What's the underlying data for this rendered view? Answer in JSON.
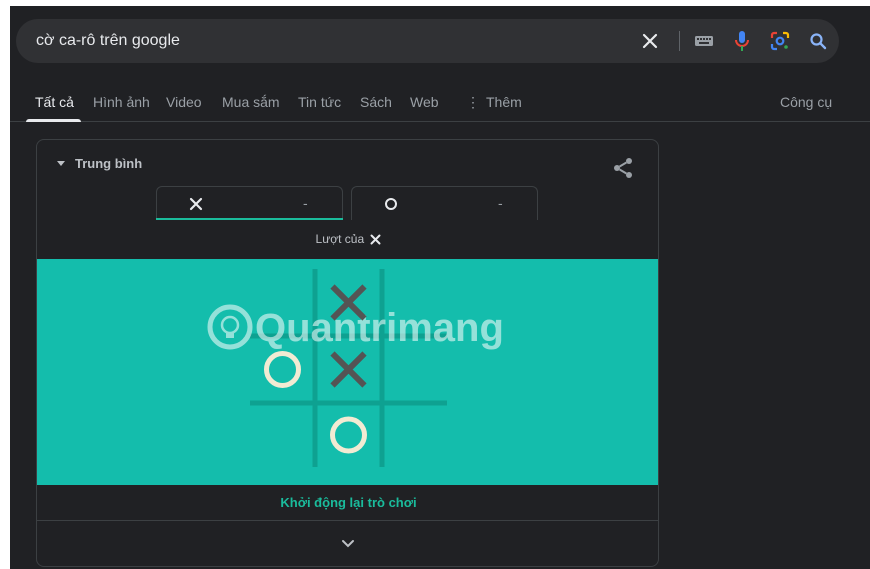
{
  "search": {
    "query": "cờ ca-rô trên google",
    "icons": [
      "close-icon",
      "keyboard-icon",
      "microphone-icon",
      "google-lens-icon",
      "search-icon"
    ]
  },
  "tabs": [
    {
      "label": "Tất cả",
      "active": true
    },
    {
      "label": "Hình ảnh"
    },
    {
      "label": "Video"
    },
    {
      "label": "Mua sắm"
    },
    {
      "label": "Tin tức"
    },
    {
      "label": "Sách"
    },
    {
      "label": "Web"
    },
    {
      "label": "Thêm",
      "icon": "more-vert-icon"
    }
  ],
  "tools_label": "Công cụ",
  "game": {
    "difficulty": "Trung bình",
    "players": [
      {
        "mark": "X",
        "score": "-"
      },
      {
        "mark": "O",
        "score": "-"
      }
    ],
    "turn_label": "Lượt của",
    "turn_mark": "X",
    "board": [
      [
        "",
        "X",
        ""
      ],
      [
        "O",
        "X",
        ""
      ],
      [
        "",
        "O",
        ""
      ]
    ],
    "board_color": "#14bdac",
    "x_color": "#545454",
    "o_color": "#f2ebd3",
    "restart_label": "Khởi động lại trò chơi",
    "watermark": "Quantrimang"
  }
}
